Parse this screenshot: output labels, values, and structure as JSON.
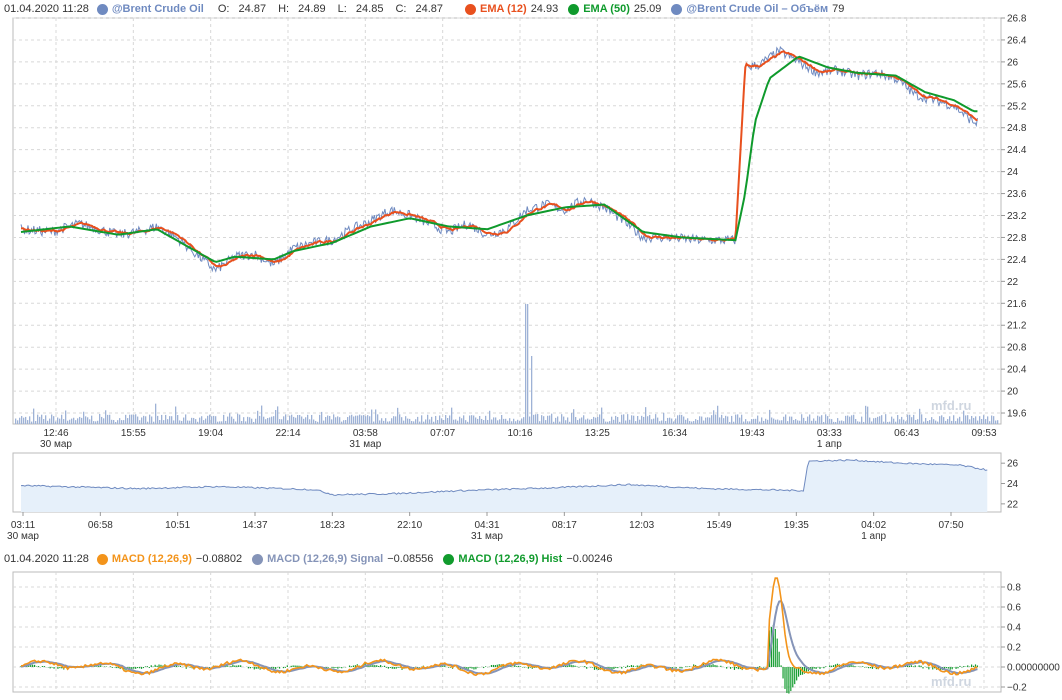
{
  "legend": {
    "datetime": "01.04.2020 11:28",
    "instrument": "@Brent Crude Oil",
    "ohlc": {
      "o_label": "O:",
      "o": "24.87",
      "h_label": "H:",
      "h": "24.89",
      "l_label": "L:",
      "l": "24.85",
      "c_label": "C:",
      "c": "24.87"
    },
    "ema12": {
      "name": "EMA (12)",
      "value": "24.93"
    },
    "ema50": {
      "name": "EMA (50)",
      "value": "25.09"
    },
    "volume": {
      "name": "@Brent Crude Oil – Объём",
      "value": "79"
    }
  },
  "macd_legend": {
    "datetime": "01.04.2020 11:28",
    "macd": {
      "name": "MACD (12,26,9)",
      "value": "−0.08802"
    },
    "signal": {
      "name": "MACD (12,26,9) Signal",
      "value": "−0.08556"
    },
    "hist": {
      "name": "MACD (12,26,9) Hist",
      "value": "−0.00246"
    }
  },
  "colors": {
    "price": "#6f8ac0",
    "ema12": "#e8501e",
    "ema50": "#0f9a2c",
    "volume": "#9eb2d6",
    "macd": "#f3941b",
    "signal": "#8594b8",
    "hist": "#119b2d",
    "grid": "#d8d8d8",
    "nav_fill": "#e6f0fa",
    "nav_line": "#6f8ac0"
  },
  "watermark": "mfd.ru",
  "chart_data": [
    {
      "type": "line",
      "name": "price",
      "y_ticks": [
        "26.8",
        "26.4",
        "26",
        "25.6",
        "25.2",
        "24.8",
        "24.4",
        "24",
        "23.6",
        "23.2",
        "22.8",
        "22.4",
        "22",
        "21.6",
        "21.2",
        "20.8",
        "20.4",
        "20",
        "19.6"
      ],
      "x_ticks": [
        {
          "t": "12:46",
          "sub": "30 мар"
        },
        {
          "t": "15:55",
          "sub": ""
        },
        {
          "t": "19:04",
          "sub": ""
        },
        {
          "t": "22:14",
          "sub": ""
        },
        {
          "t": "03:58",
          "sub": "31 мар"
        },
        {
          "t": "07:07",
          "sub": ""
        },
        {
          "t": "10:16",
          "sub": ""
        },
        {
          "t": "13:25",
          "sub": ""
        },
        {
          "t": "16:34",
          "sub": ""
        },
        {
          "t": "19:43",
          "sub": ""
        },
        {
          "t": "03:33",
          "sub": "1 апр"
        },
        {
          "t": "06:43",
          "sub": ""
        },
        {
          "t": "09:53",
          "sub": ""
        }
      ],
      "ylim": [
        19.4,
        26.8
      ],
      "price_path": [
        [
          0,
          22.95
        ],
        [
          0.03,
          22.9
        ],
        [
          0.06,
          23.05
        ],
        [
          0.08,
          22.95
        ],
        [
          0.1,
          22.85
        ],
        [
          0.12,
          22.9
        ],
        [
          0.14,
          23.0
        ],
        [
          0.16,
          22.8
        ],
        [
          0.18,
          22.5
        ],
        [
          0.2,
          22.2
        ],
        [
          0.22,
          22.45
        ],
        [
          0.24,
          22.5
        ],
        [
          0.26,
          22.3
        ],
        [
          0.28,
          22.6
        ],
        [
          0.3,
          22.7
        ],
        [
          0.32,
          22.75
        ],
        [
          0.34,
          22.95
        ],
        [
          0.36,
          23.1
        ],
        [
          0.38,
          23.3
        ],
        [
          0.4,
          23.2
        ],
        [
          0.42,
          23.05
        ],
        [
          0.44,
          22.9
        ],
        [
          0.46,
          23.05
        ],
        [
          0.48,
          22.85
        ],
        [
          0.5,
          22.95
        ],
        [
          0.52,
          23.3
        ],
        [
          0.54,
          23.4
        ],
        [
          0.56,
          23.3
        ],
        [
          0.58,
          23.5
        ],
        [
          0.6,
          23.35
        ],
        [
          0.62,
          23.1
        ],
        [
          0.64,
          22.8
        ],
        [
          0.66,
          22.8
        ],
        [
          0.68,
          22.78
        ],
        [
          0.7,
          22.75
        ],
        [
          0.72,
          22.75
        ],
        [
          0.735,
          22.75
        ],
        [
          0.745,
          25.9
        ],
        [
          0.76,
          25.95
        ],
        [
          0.78,
          26.2
        ],
        [
          0.8,
          26.0
        ],
        [
          0.82,
          25.8
        ],
        [
          0.84,
          25.85
        ],
        [
          0.86,
          25.75
        ],
        [
          0.88,
          25.8
        ],
        [
          0.9,
          25.7
        ],
        [
          0.92,
          25.4
        ],
        [
          0.94,
          25.3
        ],
        [
          0.96,
          25.2
        ],
        [
          0.98,
          24.9
        ]
      ],
      "ema50_path": [
        [
          0,
          22.9
        ],
        [
          0.05,
          23.0
        ],
        [
          0.1,
          22.85
        ],
        [
          0.14,
          22.95
        ],
        [
          0.18,
          22.55
        ],
        [
          0.2,
          22.35
        ],
        [
          0.22,
          22.45
        ],
        [
          0.26,
          22.4
        ],
        [
          0.28,
          22.55
        ],
        [
          0.32,
          22.7
        ],
        [
          0.36,
          23.0
        ],
        [
          0.4,
          23.15
        ],
        [
          0.44,
          23.0
        ],
        [
          0.48,
          22.95
        ],
        [
          0.52,
          23.2
        ],
        [
          0.56,
          23.35
        ],
        [
          0.6,
          23.4
        ],
        [
          0.64,
          22.9
        ],
        [
          0.68,
          22.8
        ],
        [
          0.735,
          22.75
        ],
        [
          0.745,
          23.6
        ],
        [
          0.755,
          24.9
        ],
        [
          0.77,
          25.7
        ],
        [
          0.8,
          26.1
        ],
        [
          0.83,
          25.9
        ],
        [
          0.86,
          25.8
        ],
        [
          0.9,
          25.75
        ],
        [
          0.93,
          25.45
        ],
        [
          0.96,
          25.3
        ],
        [
          0.98,
          25.1
        ]
      ],
      "volume_spike": {
        "x": 0.52,
        "value": "tall"
      }
    },
    {
      "type": "area",
      "name": "navigator",
      "y_ticks": [
        "26",
        "24",
        "22"
      ],
      "x_ticks": [
        {
          "t": "03:11",
          "sub": "30 мар"
        },
        {
          "t": "06:58",
          "sub": ""
        },
        {
          "t": "10:51",
          "sub": ""
        },
        {
          "t": "14:37",
          "sub": ""
        },
        {
          "t": "18:23",
          "sub": ""
        },
        {
          "t": "22:10",
          "sub": ""
        },
        {
          "t": "04:31",
          "sub": "31 мар"
        },
        {
          "t": "08:17",
          "sub": ""
        },
        {
          "t": "12:03",
          "sub": ""
        },
        {
          "t": "15:49",
          "sub": ""
        },
        {
          "t": "19:35",
          "sub": ""
        },
        {
          "t": "04:02",
          "sub": "1 апр"
        },
        {
          "t": "07:50",
          "sub": ""
        }
      ]
    },
    {
      "type": "line",
      "name": "macd",
      "y_ticks": [
        "0.8",
        "0.6",
        "0.4",
        "0.2",
        "0.00000000",
        "−0.2"
      ],
      "ylim": [
        -0.25,
        0.95
      ]
    }
  ]
}
